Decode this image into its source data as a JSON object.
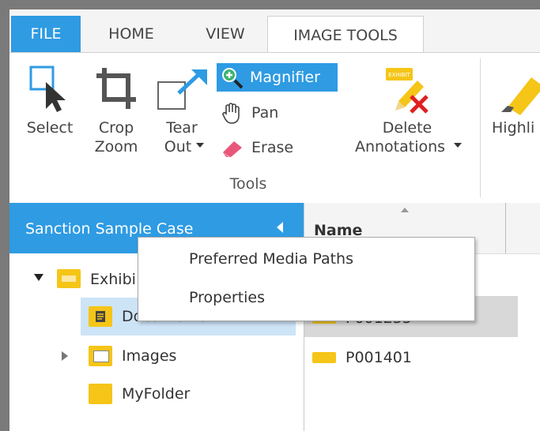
{
  "tabs": [
    {
      "label": "FILE"
    },
    {
      "label": "HOME"
    },
    {
      "label": "VIEW"
    },
    {
      "label": "IMAGE TOOLS"
    }
  ],
  "ribbon": {
    "select_label": "Select",
    "crop_zoom_label_1": "Crop",
    "crop_zoom_label_2": "Zoom",
    "tear_out_label_1": "Tear",
    "tear_out_label_2": "Out",
    "magnifier_label": "Magnifier",
    "pan_label": "Pan",
    "erase_label": "Erase",
    "tools_group_label": "Tools",
    "delete_annotations_label_1": "Delete",
    "delete_annotations_label_2": "Annotations",
    "highlight_label": "Highli",
    "exhibit_badge": "EXHIBIT"
  },
  "left_panel": {
    "title": "Sanction Sample Case",
    "tree": [
      {
        "label": "Exhibi"
      },
      {
        "label": "Documents"
      },
      {
        "label": "Images"
      },
      {
        "label": "MyFolder"
      }
    ]
  },
  "right_panel": {
    "column_header": "Name",
    "rows": [
      {
        "label": "P001255"
      },
      {
        "label": "P001401"
      }
    ]
  },
  "context_menu": {
    "items": [
      {
        "label": "Preferred Media Paths"
      },
      {
        "label": "Properties"
      }
    ]
  },
  "colors": {
    "accent": "#2e9be3",
    "folder": "#f5c518",
    "selection": "#cde4f7"
  }
}
